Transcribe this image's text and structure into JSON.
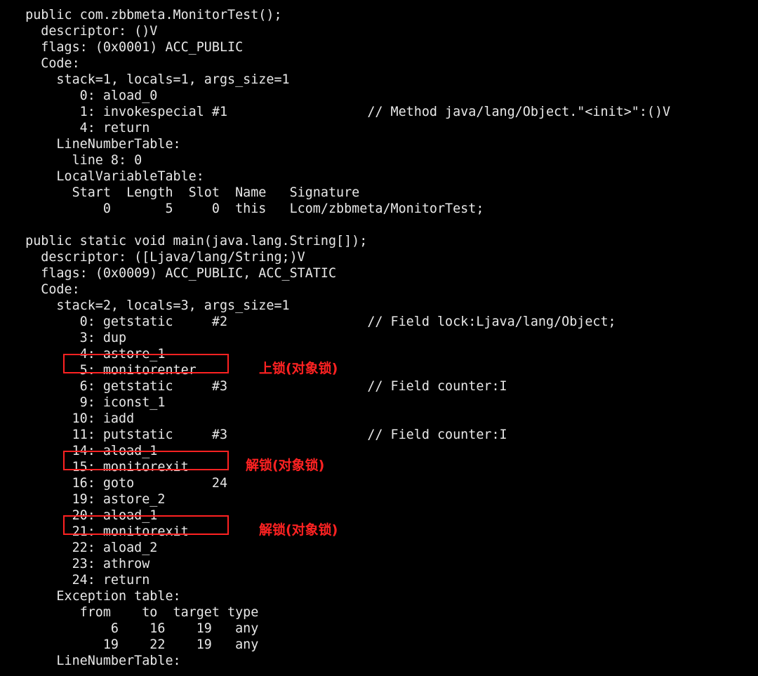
{
  "lines": [
    "  public com.zbbmeta.MonitorTest();",
    "    descriptor: ()V",
    "    flags: (0x0001) ACC_PUBLIC",
    "    Code:",
    "      stack=1, locals=1, args_size=1",
    "         0: aload_0",
    "         1: invokespecial #1                  // Method java/lang/Object.\"<init>\":()V",
    "         4: return",
    "      LineNumberTable:",
    "        line 8: 0",
    "      LocalVariableTable:",
    "        Start  Length  Slot  Name   Signature",
    "            0       5     0  this   Lcom/zbbmeta/MonitorTest;",
    "",
    "  public static void main(java.lang.String[]);",
    "    descriptor: ([Ljava/lang/String;)V",
    "    flags: (0x0009) ACC_PUBLIC, ACC_STATIC",
    "    Code:",
    "      stack=2, locals=3, args_size=1",
    "         0: getstatic     #2                  // Field lock:Ljava/lang/Object;",
    "         3: dup",
    "         4: astore_1",
    "         5: monitorenter",
    "         6: getstatic     #3                  // Field counter:I",
    "         9: iconst_1",
    "        10: iadd",
    "        11: putstatic     #3                  // Field counter:I",
    "        14: aload_1",
    "        15: monitorexit",
    "        16: goto          24",
    "        19: astore_2",
    "        20: aload_1",
    "        21: monitorexit",
    "        22: aload_2",
    "        23: athrow",
    "        24: return",
    "      Exception table:",
    "         from    to  target type",
    "             6    16    19   any",
    "            19    22    19   any",
    "      LineNumberTable:"
  ],
  "annotations": {
    "a1": "上锁(对象锁)",
    "a2": "解锁(对象锁)",
    "a3": "解锁(对象锁)"
  }
}
